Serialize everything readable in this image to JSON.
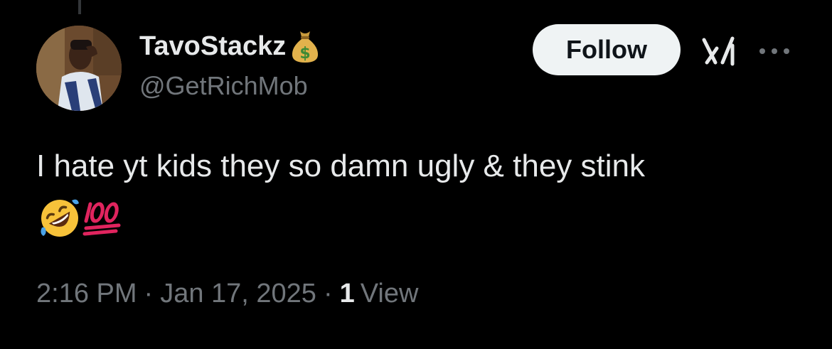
{
  "tweet": {
    "display_name": "TavoStackz",
    "handle": "@GetRichMob",
    "follow_label": "Follow",
    "text": "I hate yt kids they so damn ugly & they stink",
    "emojis": [
      "rolling-on-floor-laughing-emoji",
      "hundred-points-emoji"
    ],
    "time": "2:16 PM",
    "separator": "·",
    "date": "Jan 17, 2025",
    "view_count": "1",
    "view_label": "View"
  },
  "icons": {
    "name_badge": "money-bag-icon",
    "grok": "grok-icon",
    "more": "more-dots-icon"
  },
  "colors": {
    "background": "#000000",
    "primary_text": "#e7e9ea",
    "secondary_text": "#71767b",
    "follow_button_bg": "#eff3f4",
    "follow_button_text": "#0f1419"
  }
}
